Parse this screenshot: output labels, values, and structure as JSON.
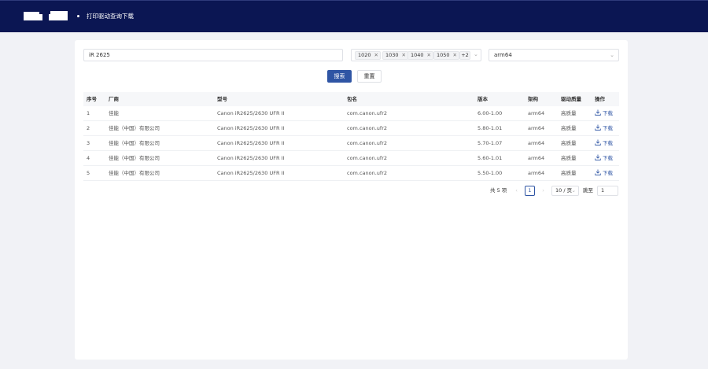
{
  "header": {
    "title": "打印驱动查询下载"
  },
  "search": {
    "keyword": "iR 2625"
  },
  "filters": {
    "versions": [
      "1020",
      "1030",
      "1040",
      "1050"
    ],
    "more": "+2",
    "arch": "arm64"
  },
  "buttons": {
    "search": "搜索",
    "reset": "重置"
  },
  "table": {
    "columns": [
      "序号",
      "厂商",
      "型号",
      "包名",
      "版本",
      "架构",
      "驱动质量",
      "操作"
    ],
    "rows": [
      [
        "1",
        "佳能",
        "Canon iR2625/2630 UFR II",
        "com.canon.ufr2",
        "6.00-1.00",
        "arm64",
        "高质量",
        "下载"
      ],
      [
        "2",
        "佳能（中国）有限公司",
        "Canon iR2625/2630 UFR II",
        "com.canon.ufr2",
        "5.80-1.01",
        "arm64",
        "高质量",
        "下载"
      ],
      [
        "3",
        "佳能（中国）有限公司",
        "Canon iR2625/2630 UFR II",
        "com.canon.ufr2",
        "5.70-1.07",
        "arm64",
        "高质量",
        "下载"
      ],
      [
        "4",
        "佳能（中国）有限公司",
        "Canon iR2625/2630 UFR II",
        "com.canon.ufr2",
        "5.60-1.01",
        "arm64",
        "高质量",
        "下载"
      ],
      [
        "5",
        "佳能（中国）有限公司",
        "Canon iR2625/2630 UFR II",
        "com.canon.ufr2",
        "5.50-1.00",
        "arm64",
        "高质量",
        "下载"
      ]
    ]
  },
  "pagination": {
    "total": "共 5 项",
    "current": "1",
    "page_size": "10 / 页",
    "jump_label": "跳至",
    "jump_value": "1"
  },
  "colors": {
    "header_bg": "#0b1653",
    "primary": "#2f55a4"
  }
}
